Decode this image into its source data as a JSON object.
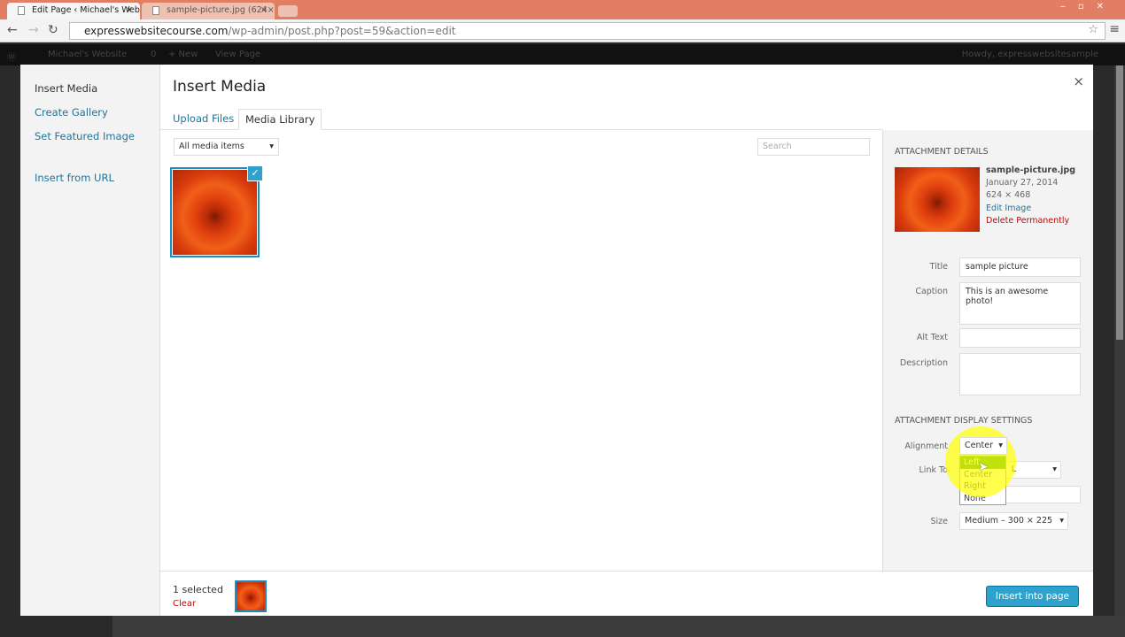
{
  "browser": {
    "tabs": [
      {
        "label": "Edit Page ‹ Michael's Web"
      },
      {
        "label": "sample-picture.jpg (624×"
      }
    ],
    "url_domain": "expresswebsitecourse.com",
    "url_path": "/wp-admin/post.php?post=59&action=edit"
  },
  "adminbar": {
    "site": "Michael's Website",
    "comments": "0",
    "new": "+ New",
    "view": "View Page",
    "howdy": "Howdy, expresswebsitesample"
  },
  "modal": {
    "title": "Insert Media",
    "close": "×",
    "menu": [
      "Insert Media",
      "Create Gallery",
      "Set Featured Image",
      "Insert from URL"
    ],
    "tabs": [
      "Upload Files",
      "Media Library"
    ],
    "filter": "All media items",
    "search_placeholder": "Search",
    "details": {
      "heading": "Attachment Details",
      "filename": "sample-picture.jpg",
      "date": "January 27, 2014",
      "dimensions": "624 × 468",
      "edit": "Edit Image",
      "delete": "Delete Permanently",
      "fields": {
        "title_label": "Title",
        "title": "sample picture",
        "caption_label": "Caption",
        "caption": "This is an awesome photo!",
        "alt_label": "Alt Text",
        "alt": "",
        "desc_label": "Description",
        "desc": ""
      }
    },
    "display": {
      "heading": "Attachment Display Settings",
      "alignment_label": "Alignment",
      "alignment": "Center",
      "alignment_options": [
        "Left",
        "Center",
        "Right",
        "None"
      ],
      "link_label": "Link To",
      "link_value": "L",
      "size_label": "Size",
      "size": "Medium – 300 × 225"
    },
    "footer": {
      "selected": "1 selected",
      "clear": "Clear",
      "insert": "Insert into page"
    }
  }
}
